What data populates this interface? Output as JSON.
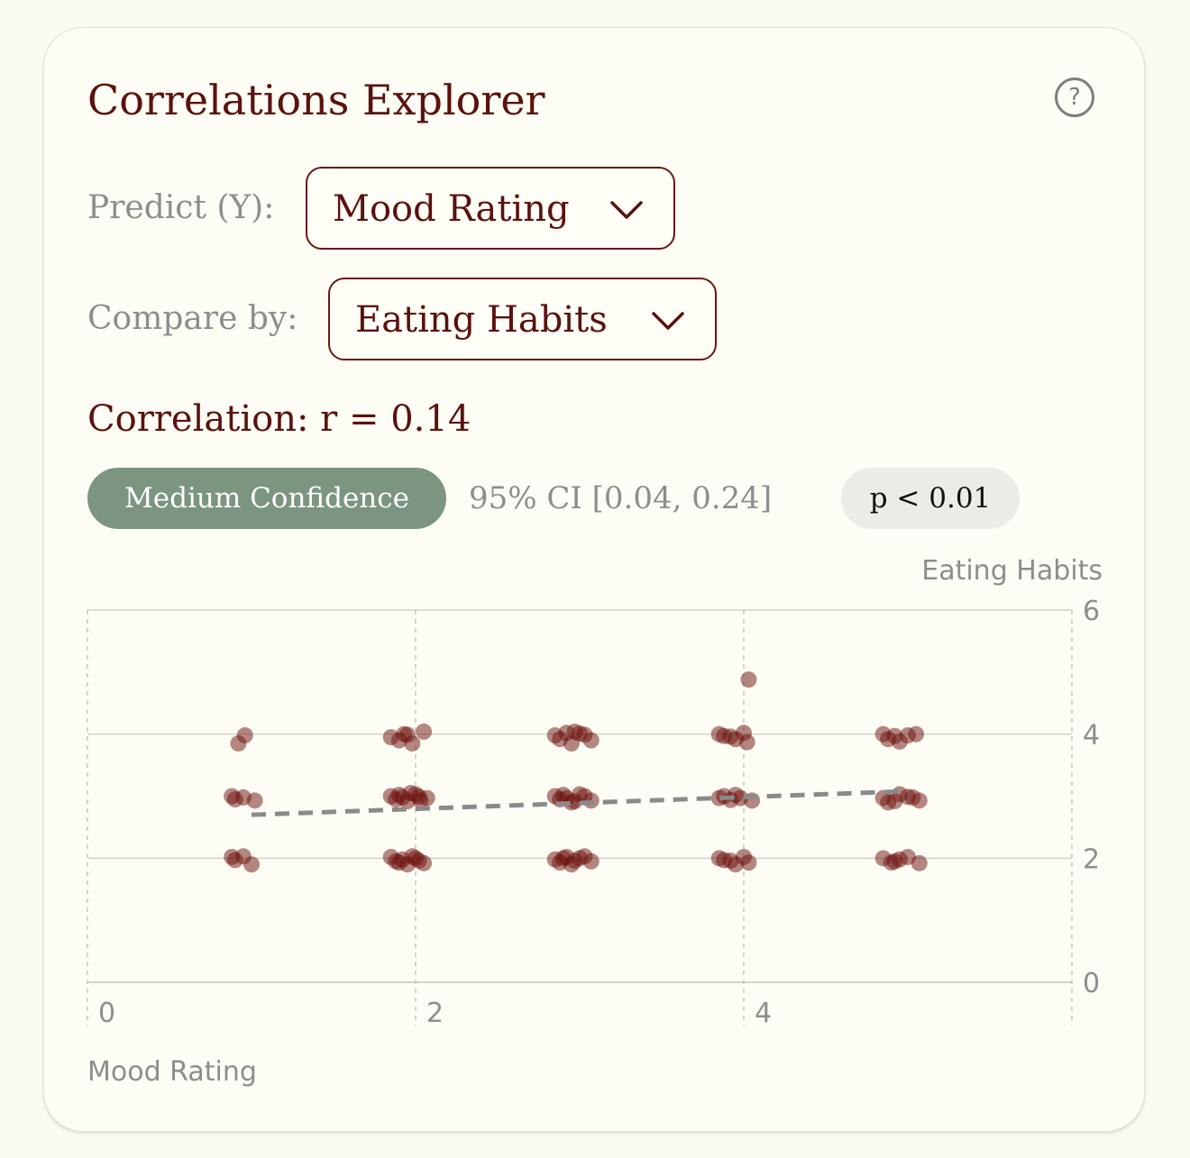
{
  "header": {
    "title": "Correlations Explorer",
    "help_icon": "question-circle-icon",
    "help_glyph": "?"
  },
  "controls": {
    "predict_label": "Predict (Y):",
    "predict_value": "Mood Rating",
    "compare_label": "Compare by:",
    "compare_value": "Eating Habits",
    "dropdown_icon": "chevron-down-icon"
  },
  "stats": {
    "correlation_text": "Correlation: r = 0.14",
    "confidence_badge": "Medium Confidence",
    "ci_text": "95% CI [0.04, 0.24]",
    "p_text": "p < 0.01"
  },
  "colors": {
    "accent": "#5a120f",
    "badge_green": "#7b9581",
    "point": "#6b0f0b",
    "trend": "#8a8a8a"
  },
  "chart_data": {
    "type": "scatter",
    "xlabel": "Mood Rating",
    "ylabel": "Eating Habits",
    "xlim": [
      0,
      6
    ],
    "ylim": [
      0,
      6
    ],
    "x_ticks": [
      0,
      2,
      4
    ],
    "y_ticks": [
      0,
      2,
      4,
      6
    ],
    "grid": true,
    "points": [
      [
        0.96,
        3.98
      ],
      [
        0.92,
        3.85
      ],
      [
        0.88,
        3.0
      ],
      [
        0.95,
        2.98
      ],
      [
        1.02,
        2.93
      ],
      [
        0.9,
        2.95
      ],
      [
        0.88,
        2.02
      ],
      [
        0.95,
        2.03
      ],
      [
        1.0,
        1.9
      ],
      [
        0.9,
        1.97
      ],
      [
        1.85,
        3.95
      ],
      [
        1.95,
        3.99
      ],
      [
        2.05,
        4.04
      ],
      [
        1.9,
        3.9
      ],
      [
        1.98,
        3.85
      ],
      [
        1.93,
        4.0
      ],
      [
        1.85,
        3.0
      ],
      [
        1.92,
        2.98
      ],
      [
        2.0,
        3.03
      ],
      [
        2.07,
        2.97
      ],
      [
        1.95,
        2.92
      ],
      [
        1.88,
        2.95
      ],
      [
        2.03,
        2.93
      ],
      [
        1.97,
        3.05
      ],
      [
        1.9,
        3.02
      ],
      [
        2.02,
        2.99
      ],
      [
        1.85,
        2.02
      ],
      [
        1.92,
        1.98
      ],
      [
        2.0,
        2.0
      ],
      [
        2.05,
        1.92
      ],
      [
        1.95,
        1.9
      ],
      [
        1.88,
        1.95
      ],
      [
        1.98,
        2.03
      ],
      [
        2.02,
        1.96
      ],
      [
        1.9,
        1.93
      ],
      [
        2.85,
        3.98
      ],
      [
        2.92,
        4.02
      ],
      [
        3.0,
        4.01
      ],
      [
        3.07,
        3.9
      ],
      [
        2.95,
        3.85
      ],
      [
        2.88,
        3.92
      ],
      [
        3.03,
        3.99
      ],
      [
        2.97,
        4.04
      ],
      [
        2.85,
        3.0
      ],
      [
        2.92,
        2.97
      ],
      [
        3.0,
        3.03
      ],
      [
        3.07,
        2.93
      ],
      [
        2.95,
        2.9
      ],
      [
        2.88,
        2.95
      ],
      [
        3.03,
        3.0
      ],
      [
        2.97,
        2.92
      ],
      [
        2.9,
        3.02
      ],
      [
        2.85,
        1.98
      ],
      [
        2.92,
        2.02
      ],
      [
        3.0,
        2.0
      ],
      [
        3.07,
        1.95
      ],
      [
        2.95,
        1.9
      ],
      [
        2.88,
        1.93
      ],
      [
        3.03,
        2.03
      ],
      [
        2.97,
        1.96
      ],
      [
        2.9,
        2.0
      ],
      [
        4.03,
        4.88
      ],
      [
        3.85,
        4.0
      ],
      [
        3.92,
        3.96
      ],
      [
        4.0,
        4.02
      ],
      [
        4.02,
        3.87
      ],
      [
        3.95,
        3.92
      ],
      [
        3.88,
        3.97
      ],
      [
        3.85,
        2.97
      ],
      [
        3.92,
        2.94
      ],
      [
        3.98,
        2.97
      ],
      [
        4.05,
        2.93
      ],
      [
        3.88,
        3.0
      ],
      [
        3.95,
        3.02
      ],
      [
        3.85,
        2.0
      ],
      [
        3.92,
        1.96
      ],
      [
        4.0,
        2.02
      ],
      [
        4.03,
        1.93
      ],
      [
        3.95,
        1.9
      ],
      [
        3.88,
        1.97
      ],
      [
        4.85,
        4.0
      ],
      [
        4.92,
        3.97
      ],
      [
        5.0,
        3.98
      ],
      [
        5.05,
        4.0
      ],
      [
        4.95,
        3.88
      ],
      [
        4.88,
        3.92
      ],
      [
        4.85,
        2.97
      ],
      [
        4.92,
        2.92
      ],
      [
        5.0,
        2.99
      ],
      [
        5.07,
        2.93
      ],
      [
        4.95,
        3.03
      ],
      [
        4.88,
        2.9
      ],
      [
        5.03,
        2.98
      ],
      [
        4.85,
        2.0
      ],
      [
        4.92,
        1.95
      ],
      [
        5.0,
        2.02
      ],
      [
        5.07,
        1.92
      ],
      [
        4.95,
        1.98
      ],
      [
        4.9,
        1.93
      ]
    ],
    "trend_line": {
      "x": [
        1,
        5
      ],
      "y": [
        2.7,
        3.08
      ]
    }
  }
}
